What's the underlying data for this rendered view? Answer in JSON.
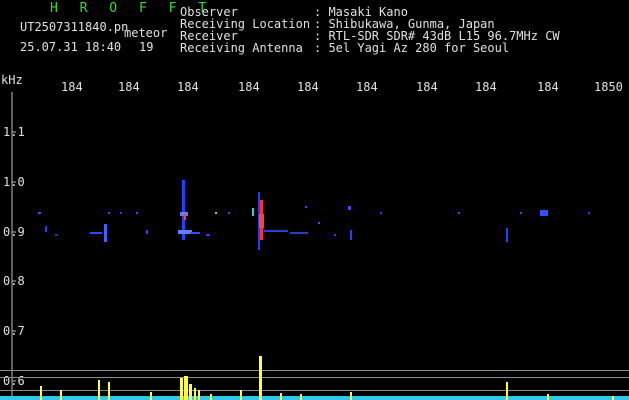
{
  "header": {
    "app_title": "H R O F F T",
    "filename": "UT2507311840.pn",
    "detection_label": "meteor",
    "datetime": "25.07.31 18:40",
    "detection_count": "19",
    "info_labels": [
      "Observer",
      "Receiving Location",
      "Receiver",
      "Receiving Antenna"
    ],
    "info_values": [
      ": Masaki Kano",
      ": Shibukawa, Gunma, Japan",
      ": RTL-SDR SDR# 43dB L15 96.7MHz CW",
      ": 5el Yagi Az 280 for Seoul"
    ]
  },
  "spectrogram": {
    "y_unit_label": "kHz",
    "y_tick_labels": [
      "1.1",
      "1.0",
      "0.9",
      "0.8",
      "0.7",
      "0.6"
    ],
    "x_tick_labels": [
      "184",
      "184",
      "184",
      "184",
      "184",
      "184",
      "184",
      "184",
      "184",
      "1850"
    ],
    "colors": {
      "background": "#000000",
      "trace": "#2040ff",
      "hot": "#ff3030",
      "yellow": "#ffff40",
      "cyan": "#40e0ff",
      "guide": "#9a9a9a"
    }
  }
}
